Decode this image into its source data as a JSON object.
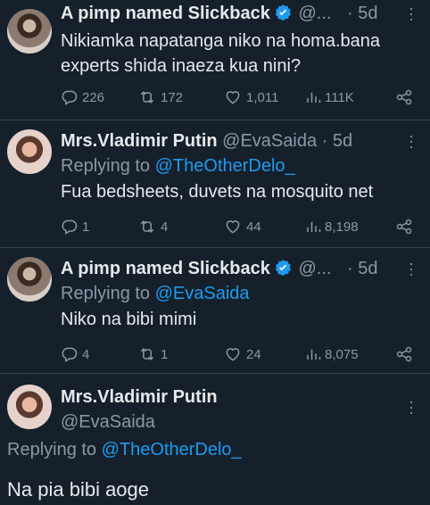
{
  "tweets": [
    {
      "name": "A pimp named Slickback",
      "handle": "@...",
      "time": "· 5d",
      "verified": true,
      "avatar": "man",
      "replying_to_label": "",
      "replying_to_handle": "",
      "text": "Nikiamka napatanga niko na homa.bana experts shida inaeza kua nini?",
      "replies": "226",
      "reposts": "172",
      "likes": "1,011",
      "views": "111K"
    },
    {
      "name": "Mrs.Vladimir Putin",
      "handle": "@EvaSaida",
      "time": "· 5d",
      "verified": false,
      "avatar": "woman",
      "replying_to_label": "Replying to",
      "replying_to_handle": "@TheOtherDelo_",
      "text": "Fua bedsheets, duvets na mosquito net",
      "replies": "1",
      "reposts": "4",
      "likes": "44",
      "views": "8,198"
    },
    {
      "name": "A pimp named Slickback",
      "handle": "@...",
      "time": "· 5d",
      "verified": true,
      "avatar": "man",
      "replying_to_label": "Replying to",
      "replying_to_handle": "@EvaSaida",
      "text": "Niko na bibi mimi",
      "replies": "4",
      "reposts": "1",
      "likes": "24",
      "views": "8,075"
    }
  ],
  "final": {
    "name": "Mrs.Vladimir Putin",
    "handle": "@EvaSaida",
    "replying_to_label": "Replying to",
    "replying_to_handle": "@TheOtherDelo_",
    "text": "Na pia bibi aoge"
  },
  "icons": {
    "verified": "verified-badge-icon",
    "more": "more-dots-icon",
    "reply": "reply-icon",
    "repost": "repost-icon",
    "like": "heart-icon",
    "views": "views-icon",
    "share": "share-icon"
  },
  "colors": {
    "background": "#15202b",
    "link": "#1d9bf0",
    "muted": "#8b98a5",
    "divider": "#38444d"
  }
}
